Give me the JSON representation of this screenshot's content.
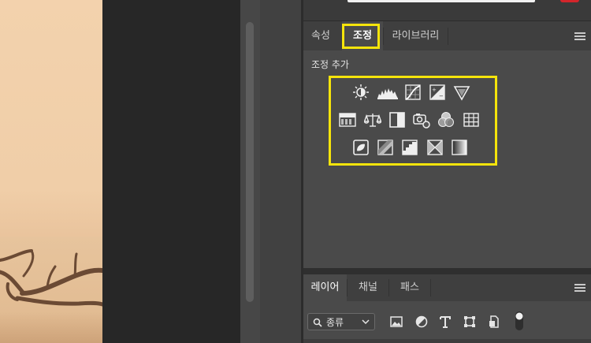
{
  "adjustments_panel": {
    "tabs": [
      {
        "label": "속성",
        "active": false
      },
      {
        "label": "조정",
        "active": true
      },
      {
        "label": "라이브러리",
        "active": false
      }
    ],
    "section_title": "조정 추가",
    "icons": {
      "row1": [
        "brightness-contrast-icon",
        "levels-icon",
        "curves-icon",
        "exposure-icon",
        "vibrance-icon"
      ],
      "row2": [
        "hue-saturation-icon",
        "color-balance-icon",
        "black-white-icon",
        "photo-filter-icon",
        "channel-mixer-icon",
        "color-lookup-icon"
      ],
      "row3": [
        "invert-icon",
        "posterize-icon",
        "threshold-icon",
        "selective-color-icon",
        "gradient-map-icon"
      ]
    },
    "highlight_color": "#f5e40b"
  },
  "layers_panel": {
    "tabs": [
      {
        "label": "레이어",
        "active": true
      },
      {
        "label": "채널",
        "active": false
      },
      {
        "label": "패스",
        "active": false
      }
    ],
    "filter": {
      "selected": "종류"
    },
    "filter_tools": [
      "image-filter-icon",
      "adjustment-filter-icon",
      "type-filter-icon",
      "shape-filter-icon",
      "smart-object-filter-icon"
    ]
  },
  "colors": {
    "panel_bg": "#4a4a4a",
    "tab_bar_bg": "#3f3f3f",
    "canvas_bg": "#272727",
    "accent_red": "#d3252b"
  }
}
